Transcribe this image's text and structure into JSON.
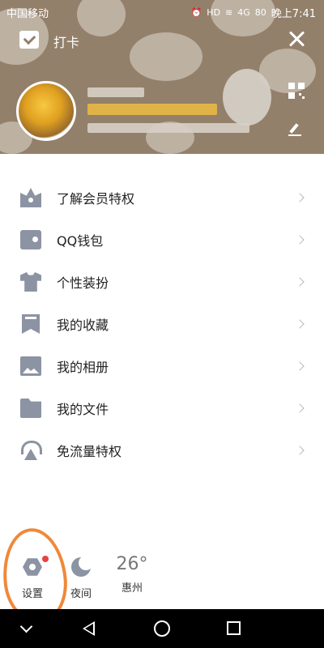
{
  "status_bar": {
    "carrier": "中国移动",
    "network": "4G",
    "hd_badge": "HD",
    "battery": "80",
    "time": "晚上7:41"
  },
  "header": {
    "checkin_label": "打卡"
  },
  "menu": {
    "items": [
      {
        "label": "了解会员特权",
        "icon": "crown-icon"
      },
      {
        "label": "QQ钱包",
        "icon": "wallet-icon"
      },
      {
        "label": "个性装扮",
        "icon": "shirt-icon"
      },
      {
        "label": "我的收藏",
        "icon": "bookmark-icon"
      },
      {
        "label": "我的相册",
        "icon": "photo-icon"
      },
      {
        "label": "我的文件",
        "icon": "folder-icon"
      },
      {
        "label": "免流量特权",
        "icon": "signal-tower-icon"
      }
    ]
  },
  "bottom": {
    "settings_label": "设置",
    "night_label": "夜间",
    "temperature": "26°",
    "city": "惠州"
  },
  "colors": {
    "header_bg": "#93806b",
    "icon_gray": "#8c93a3",
    "badge_red": "#e64340",
    "annotation_orange": "#f0883a"
  }
}
